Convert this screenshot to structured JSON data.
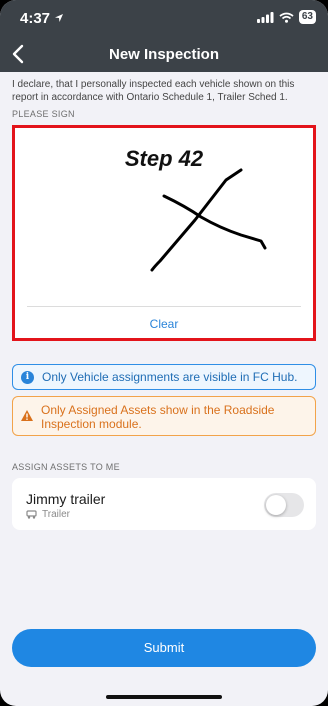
{
  "status_bar": {
    "time": "4:37",
    "battery": "63"
  },
  "header": {
    "title": "New Inspection"
  },
  "declaration": "I declare, that I personally inspected each vehicle shown on this report in accordance with Ontario Schedule 1, Trailer Sched 1.",
  "signature": {
    "section_label": "PLEASE SIGN",
    "annotation": "Step 42",
    "clear_label": "Clear"
  },
  "notices": {
    "info": "Only Vehicle assignments are visible in FC Hub.",
    "warning": "Only Assigned Assets show in the Roadside Inspection module."
  },
  "assets": {
    "section_label": "ASSIGN ASSETS TO ME",
    "items": [
      {
        "name": "Jimmy trailer",
        "type": "Trailer",
        "assigned": false,
        "icon": "trailer-icon"
      }
    ]
  },
  "submit_label": "Submit",
  "colors": {
    "accent": "#1f87e3",
    "header": "#3c4248",
    "highlight": "#e3141b",
    "warning": "#d9711c"
  }
}
